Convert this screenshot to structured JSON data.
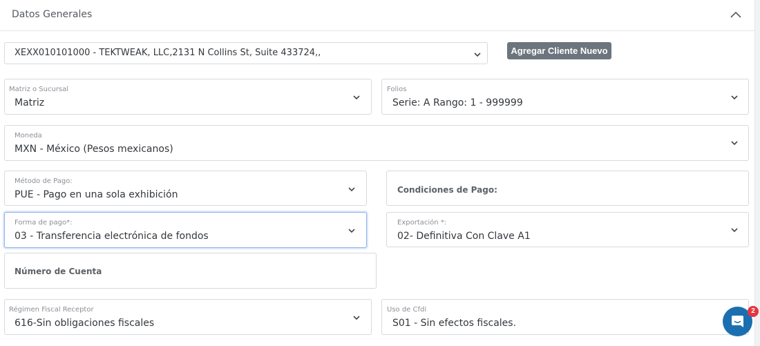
{
  "panel": {
    "title": "Datos Generales"
  },
  "client": {
    "value": "XEXX010101000 - TEKTWEAK, LLC,2131 N Collins St, Suite 433724,,",
    "add_button_label": "Agregar Cliente Nuevo"
  },
  "fields": {
    "matriz": {
      "label": "Matriz o Sucursal",
      "value": "Matriz"
    },
    "folios": {
      "label": "Folios",
      "value": "Serie: A Rango: 1 - 999999"
    },
    "moneda": {
      "label": "Moneda",
      "value": "MXN - México (Pesos mexicanos)"
    },
    "metodo_pago": {
      "label": "Método de Pago:",
      "value": "PUE - Pago en una sola exhibición"
    },
    "condiciones_pago": {
      "placeholder": "Condiciones de Pago:"
    },
    "forma_pago": {
      "label": "Forma de pago*:",
      "value": "03 - Transferencia electrónica de fondos"
    },
    "exportacion": {
      "label": "Exportación *:",
      "value": "02- Definitiva Con Clave A1"
    },
    "numero_cuenta": {
      "placeholder": "Número de Cuenta"
    },
    "regimen_fiscal": {
      "label": "Régimen Fiscal Receptor",
      "value": "616-Sin obligaciones fiscales"
    },
    "uso_cfdi": {
      "label": "Uso de Cfdi",
      "value": "S01 - Sin efectos fiscales."
    }
  },
  "chat": {
    "badge_count": "2"
  },
  "icons": {
    "collapse": "chevron-up-icon",
    "dropdown": "chevron-down-icon",
    "chat": "chat-bubble-icon"
  },
  "colors": {
    "button_bg": "#6c757d",
    "focus_border": "#8fb3ee",
    "chat_button": "#1b6fb0",
    "badge": "#e6343f"
  }
}
